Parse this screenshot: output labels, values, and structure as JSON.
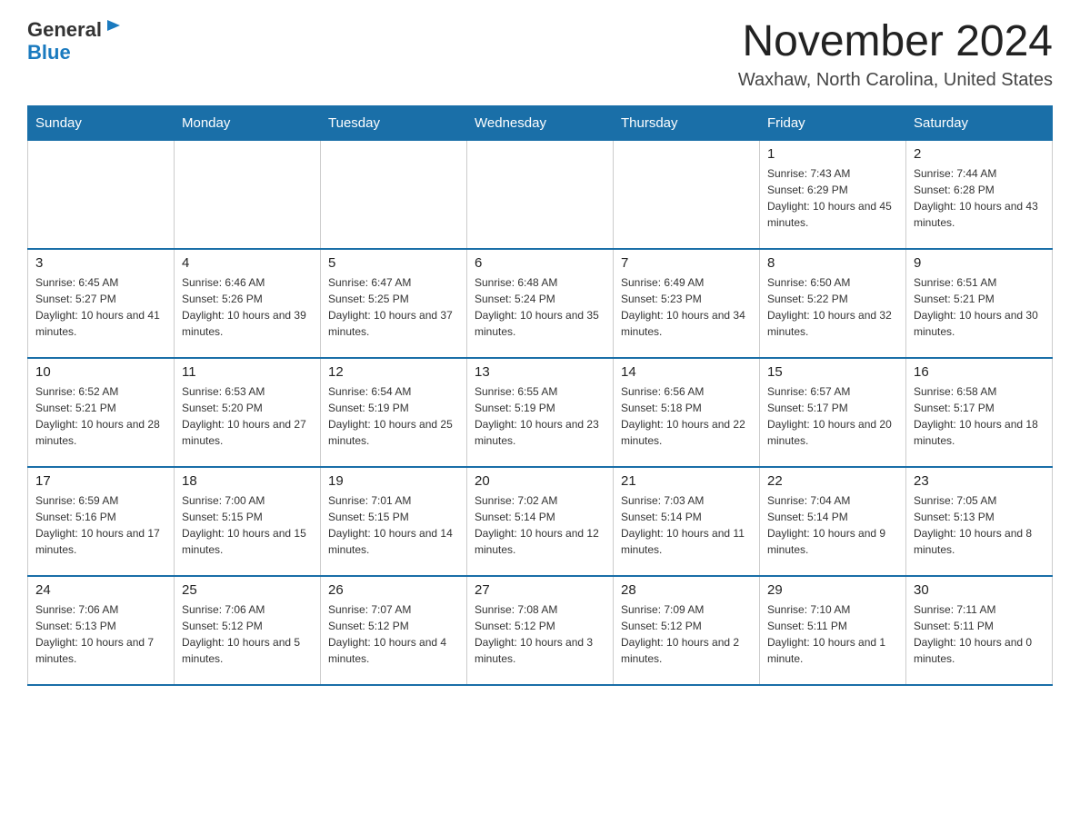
{
  "header": {
    "logo_general": "General",
    "logo_blue": "Blue",
    "month_title": "November 2024",
    "location": "Waxhaw, North Carolina, United States"
  },
  "calendar": {
    "days_of_week": [
      "Sunday",
      "Monday",
      "Tuesday",
      "Wednesday",
      "Thursday",
      "Friday",
      "Saturday"
    ],
    "weeks": [
      [
        {
          "day": "",
          "sunrise": "",
          "sunset": "",
          "daylight": ""
        },
        {
          "day": "",
          "sunrise": "",
          "sunset": "",
          "daylight": ""
        },
        {
          "day": "",
          "sunrise": "",
          "sunset": "",
          "daylight": ""
        },
        {
          "day": "",
          "sunrise": "",
          "sunset": "",
          "daylight": ""
        },
        {
          "day": "",
          "sunrise": "",
          "sunset": "",
          "daylight": ""
        },
        {
          "day": "1",
          "sunrise": "Sunrise: 7:43 AM",
          "sunset": "Sunset: 6:29 PM",
          "daylight": "Daylight: 10 hours and 45 minutes."
        },
        {
          "day": "2",
          "sunrise": "Sunrise: 7:44 AM",
          "sunset": "Sunset: 6:28 PM",
          "daylight": "Daylight: 10 hours and 43 minutes."
        }
      ],
      [
        {
          "day": "3",
          "sunrise": "Sunrise: 6:45 AM",
          "sunset": "Sunset: 5:27 PM",
          "daylight": "Daylight: 10 hours and 41 minutes."
        },
        {
          "day": "4",
          "sunrise": "Sunrise: 6:46 AM",
          "sunset": "Sunset: 5:26 PM",
          "daylight": "Daylight: 10 hours and 39 minutes."
        },
        {
          "day": "5",
          "sunrise": "Sunrise: 6:47 AM",
          "sunset": "Sunset: 5:25 PM",
          "daylight": "Daylight: 10 hours and 37 minutes."
        },
        {
          "day": "6",
          "sunrise": "Sunrise: 6:48 AM",
          "sunset": "Sunset: 5:24 PM",
          "daylight": "Daylight: 10 hours and 35 minutes."
        },
        {
          "day": "7",
          "sunrise": "Sunrise: 6:49 AM",
          "sunset": "Sunset: 5:23 PM",
          "daylight": "Daylight: 10 hours and 34 minutes."
        },
        {
          "day": "8",
          "sunrise": "Sunrise: 6:50 AM",
          "sunset": "Sunset: 5:22 PM",
          "daylight": "Daylight: 10 hours and 32 minutes."
        },
        {
          "day": "9",
          "sunrise": "Sunrise: 6:51 AM",
          "sunset": "Sunset: 5:21 PM",
          "daylight": "Daylight: 10 hours and 30 minutes."
        }
      ],
      [
        {
          "day": "10",
          "sunrise": "Sunrise: 6:52 AM",
          "sunset": "Sunset: 5:21 PM",
          "daylight": "Daylight: 10 hours and 28 minutes."
        },
        {
          "day": "11",
          "sunrise": "Sunrise: 6:53 AM",
          "sunset": "Sunset: 5:20 PM",
          "daylight": "Daylight: 10 hours and 27 minutes."
        },
        {
          "day": "12",
          "sunrise": "Sunrise: 6:54 AM",
          "sunset": "Sunset: 5:19 PM",
          "daylight": "Daylight: 10 hours and 25 minutes."
        },
        {
          "day": "13",
          "sunrise": "Sunrise: 6:55 AM",
          "sunset": "Sunset: 5:19 PM",
          "daylight": "Daylight: 10 hours and 23 minutes."
        },
        {
          "day": "14",
          "sunrise": "Sunrise: 6:56 AM",
          "sunset": "Sunset: 5:18 PM",
          "daylight": "Daylight: 10 hours and 22 minutes."
        },
        {
          "day": "15",
          "sunrise": "Sunrise: 6:57 AM",
          "sunset": "Sunset: 5:17 PM",
          "daylight": "Daylight: 10 hours and 20 minutes."
        },
        {
          "day": "16",
          "sunrise": "Sunrise: 6:58 AM",
          "sunset": "Sunset: 5:17 PM",
          "daylight": "Daylight: 10 hours and 18 minutes."
        }
      ],
      [
        {
          "day": "17",
          "sunrise": "Sunrise: 6:59 AM",
          "sunset": "Sunset: 5:16 PM",
          "daylight": "Daylight: 10 hours and 17 minutes."
        },
        {
          "day": "18",
          "sunrise": "Sunrise: 7:00 AM",
          "sunset": "Sunset: 5:15 PM",
          "daylight": "Daylight: 10 hours and 15 minutes."
        },
        {
          "day": "19",
          "sunrise": "Sunrise: 7:01 AM",
          "sunset": "Sunset: 5:15 PM",
          "daylight": "Daylight: 10 hours and 14 minutes."
        },
        {
          "day": "20",
          "sunrise": "Sunrise: 7:02 AM",
          "sunset": "Sunset: 5:14 PM",
          "daylight": "Daylight: 10 hours and 12 minutes."
        },
        {
          "day": "21",
          "sunrise": "Sunrise: 7:03 AM",
          "sunset": "Sunset: 5:14 PM",
          "daylight": "Daylight: 10 hours and 11 minutes."
        },
        {
          "day": "22",
          "sunrise": "Sunrise: 7:04 AM",
          "sunset": "Sunset: 5:14 PM",
          "daylight": "Daylight: 10 hours and 9 minutes."
        },
        {
          "day": "23",
          "sunrise": "Sunrise: 7:05 AM",
          "sunset": "Sunset: 5:13 PM",
          "daylight": "Daylight: 10 hours and 8 minutes."
        }
      ],
      [
        {
          "day": "24",
          "sunrise": "Sunrise: 7:06 AM",
          "sunset": "Sunset: 5:13 PM",
          "daylight": "Daylight: 10 hours and 7 minutes."
        },
        {
          "day": "25",
          "sunrise": "Sunrise: 7:06 AM",
          "sunset": "Sunset: 5:12 PM",
          "daylight": "Daylight: 10 hours and 5 minutes."
        },
        {
          "day": "26",
          "sunrise": "Sunrise: 7:07 AM",
          "sunset": "Sunset: 5:12 PM",
          "daylight": "Daylight: 10 hours and 4 minutes."
        },
        {
          "day": "27",
          "sunrise": "Sunrise: 7:08 AM",
          "sunset": "Sunset: 5:12 PM",
          "daylight": "Daylight: 10 hours and 3 minutes."
        },
        {
          "day": "28",
          "sunrise": "Sunrise: 7:09 AM",
          "sunset": "Sunset: 5:12 PM",
          "daylight": "Daylight: 10 hours and 2 minutes."
        },
        {
          "day": "29",
          "sunrise": "Sunrise: 7:10 AM",
          "sunset": "Sunset: 5:11 PM",
          "daylight": "Daylight: 10 hours and 1 minute."
        },
        {
          "day": "30",
          "sunrise": "Sunrise: 7:11 AM",
          "sunset": "Sunset: 5:11 PM",
          "daylight": "Daylight: 10 hours and 0 minutes."
        }
      ]
    ]
  }
}
